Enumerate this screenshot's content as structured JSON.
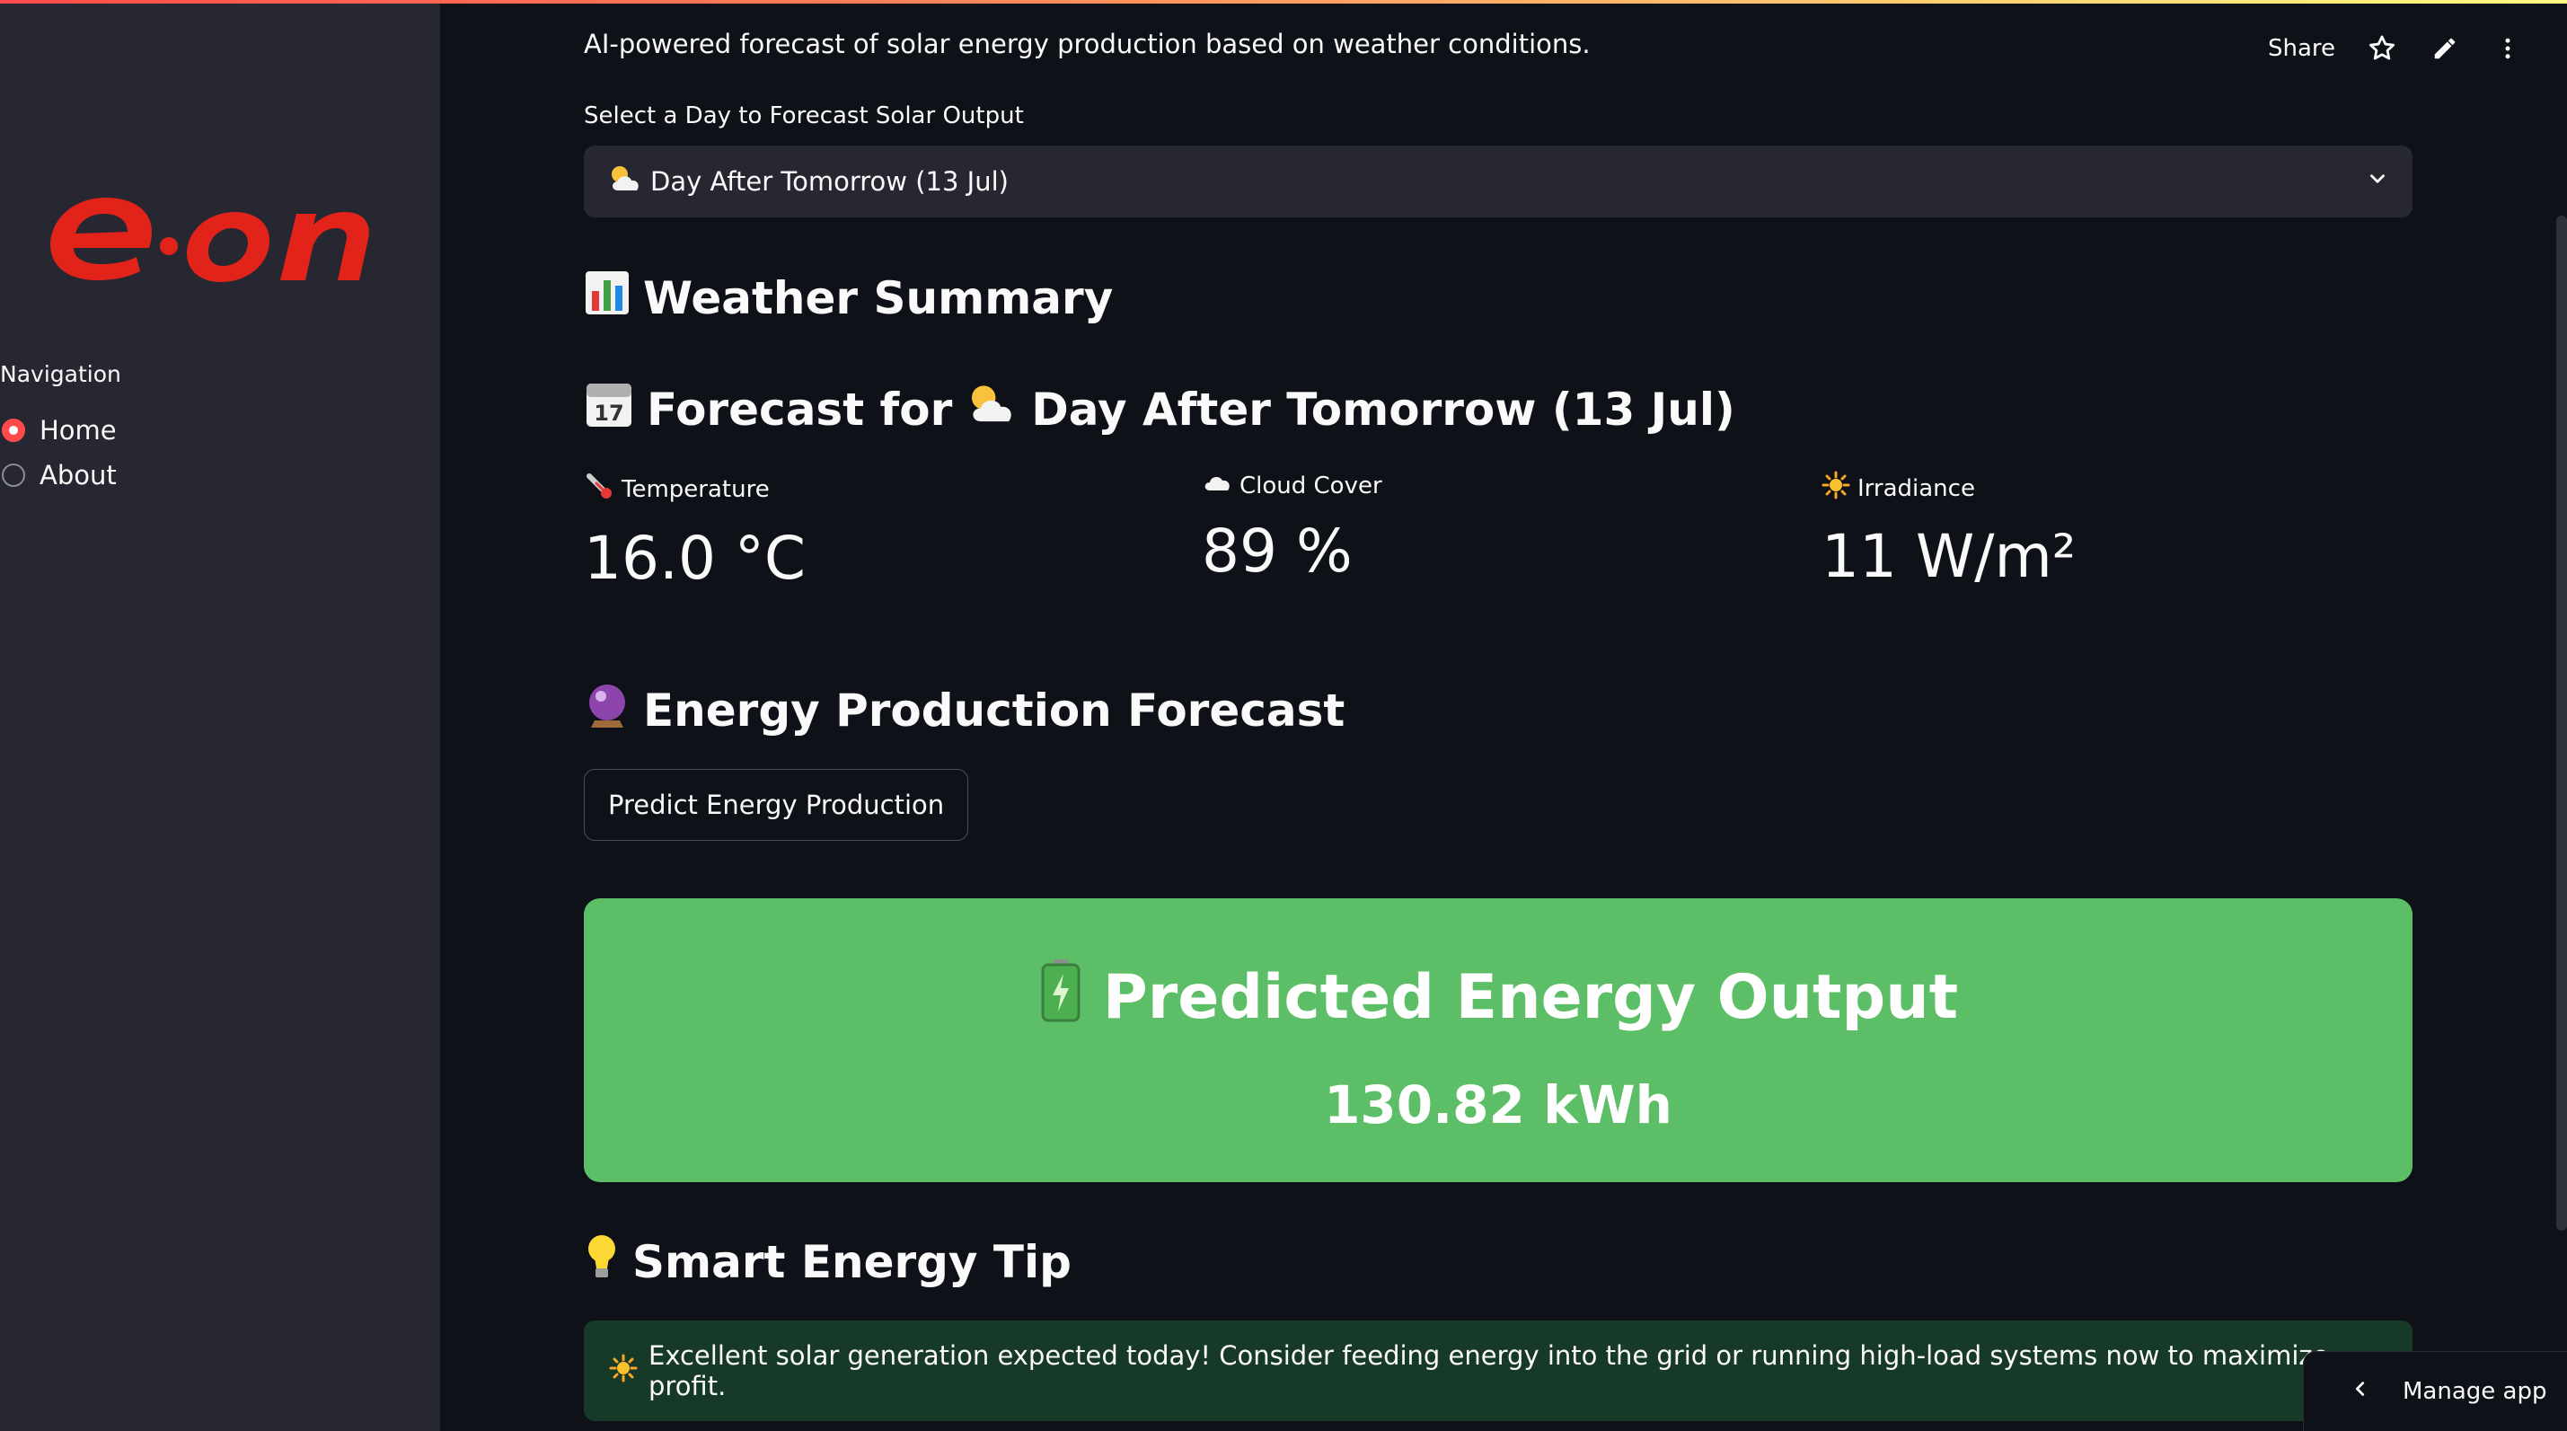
{
  "app": {
    "subtitle": "AI-powered forecast of solar energy production based on weather conditions."
  },
  "toolbar": {
    "share_label": "Share",
    "icons": [
      "star-icon",
      "pencil-icon",
      "more-vertical-icon"
    ]
  },
  "sidebar": {
    "logo_text": "e·on",
    "nav_label": "Navigation",
    "items": [
      {
        "label": "Home",
        "selected": true
      },
      {
        "label": "About",
        "selected": false
      }
    ],
    "accent_color": "#ff4b4b"
  },
  "selector": {
    "label": "Select a Day to Forecast Solar Output",
    "icon": "sun-behind-cloud-icon",
    "selected": "Day After Tomorrow (13 Jul)"
  },
  "weather_summary": {
    "heading": "Weather Summary",
    "icon": "bar-chart-icon"
  },
  "forecast": {
    "heading_prefix": "Forecast for",
    "heading_day": "Day After Tomorrow (13 Jul)",
    "calendar_icon": "calendar-icon",
    "day_icon": "sun-behind-cloud-icon",
    "metrics": [
      {
        "label": "Temperature",
        "value": "16.0 °C",
        "icon": "thermometer-icon"
      },
      {
        "label": "Cloud Cover",
        "value": "89 %",
        "icon": "cloud-icon"
      },
      {
        "label": "Irradiance",
        "value": "11 W/m²",
        "icon": "sun-icon"
      }
    ]
  },
  "energy": {
    "heading": "Energy Production Forecast",
    "icon": "crystal-ball-icon",
    "button_label": "Predict Energy Production"
  },
  "result": {
    "title": "Predicted Energy Output",
    "icon": "battery-icon",
    "value": "130.82 kWh",
    "color": "#5cbf68"
  },
  "tip": {
    "heading": "Smart Energy Tip",
    "icon": "light-bulb-icon",
    "message": "Excellent solar generation expected today! Consider feeding energy into the grid or running high-load systems now to maximize profit.",
    "message_icon": "sun-icon",
    "background": "#173928"
  },
  "footer": {
    "manage_label": "Manage app"
  }
}
